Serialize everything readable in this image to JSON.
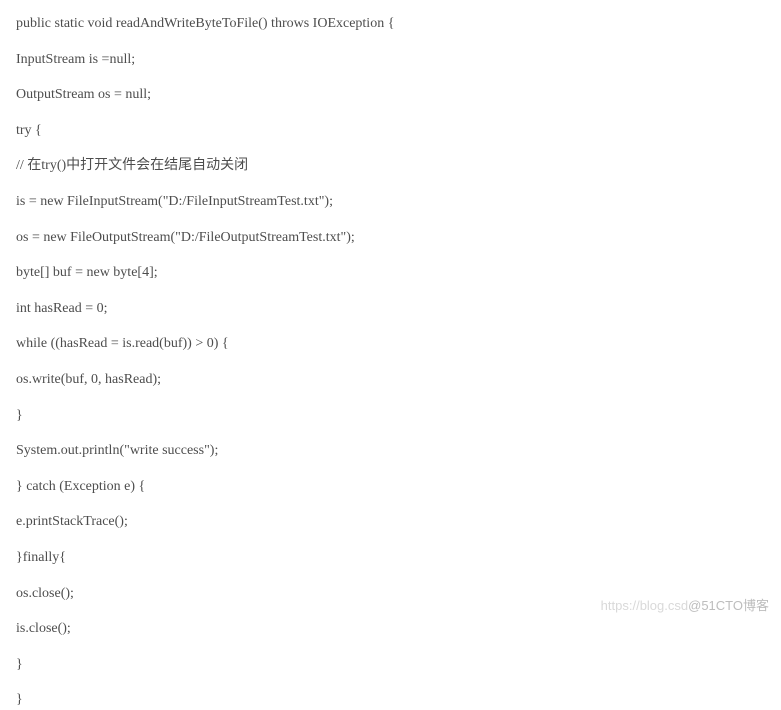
{
  "code": {
    "lines": [
      "public static void readAndWriteByteToFile() throws IOException {",
      "InputStream is =null;",
      "OutputStream os = null;",
      "try {",
      "// 在try()中打开文件会在结尾自动关闭",
      "is = new FileInputStream(\"D:/FileInputStreamTest.txt\");",
      "os = new FileOutputStream(\"D:/FileOutputStreamTest.txt\");",
      "byte[] buf = new byte[4];",
      "int hasRead = 0;",
      "while ((hasRead = is.read(buf)) > 0) {",
      "os.write(buf, 0, hasRead);",
      "}",
      "System.out.println(\"write success\");",
      "} catch (Exception e) {",
      "e.printStackTrace();",
      "}finally{",
      "os.close();",
      "is.close();",
      "}",
      "}"
    ]
  },
  "watermark": {
    "faint": "https://blog.csd",
    "strong": "@51CTO博客"
  }
}
